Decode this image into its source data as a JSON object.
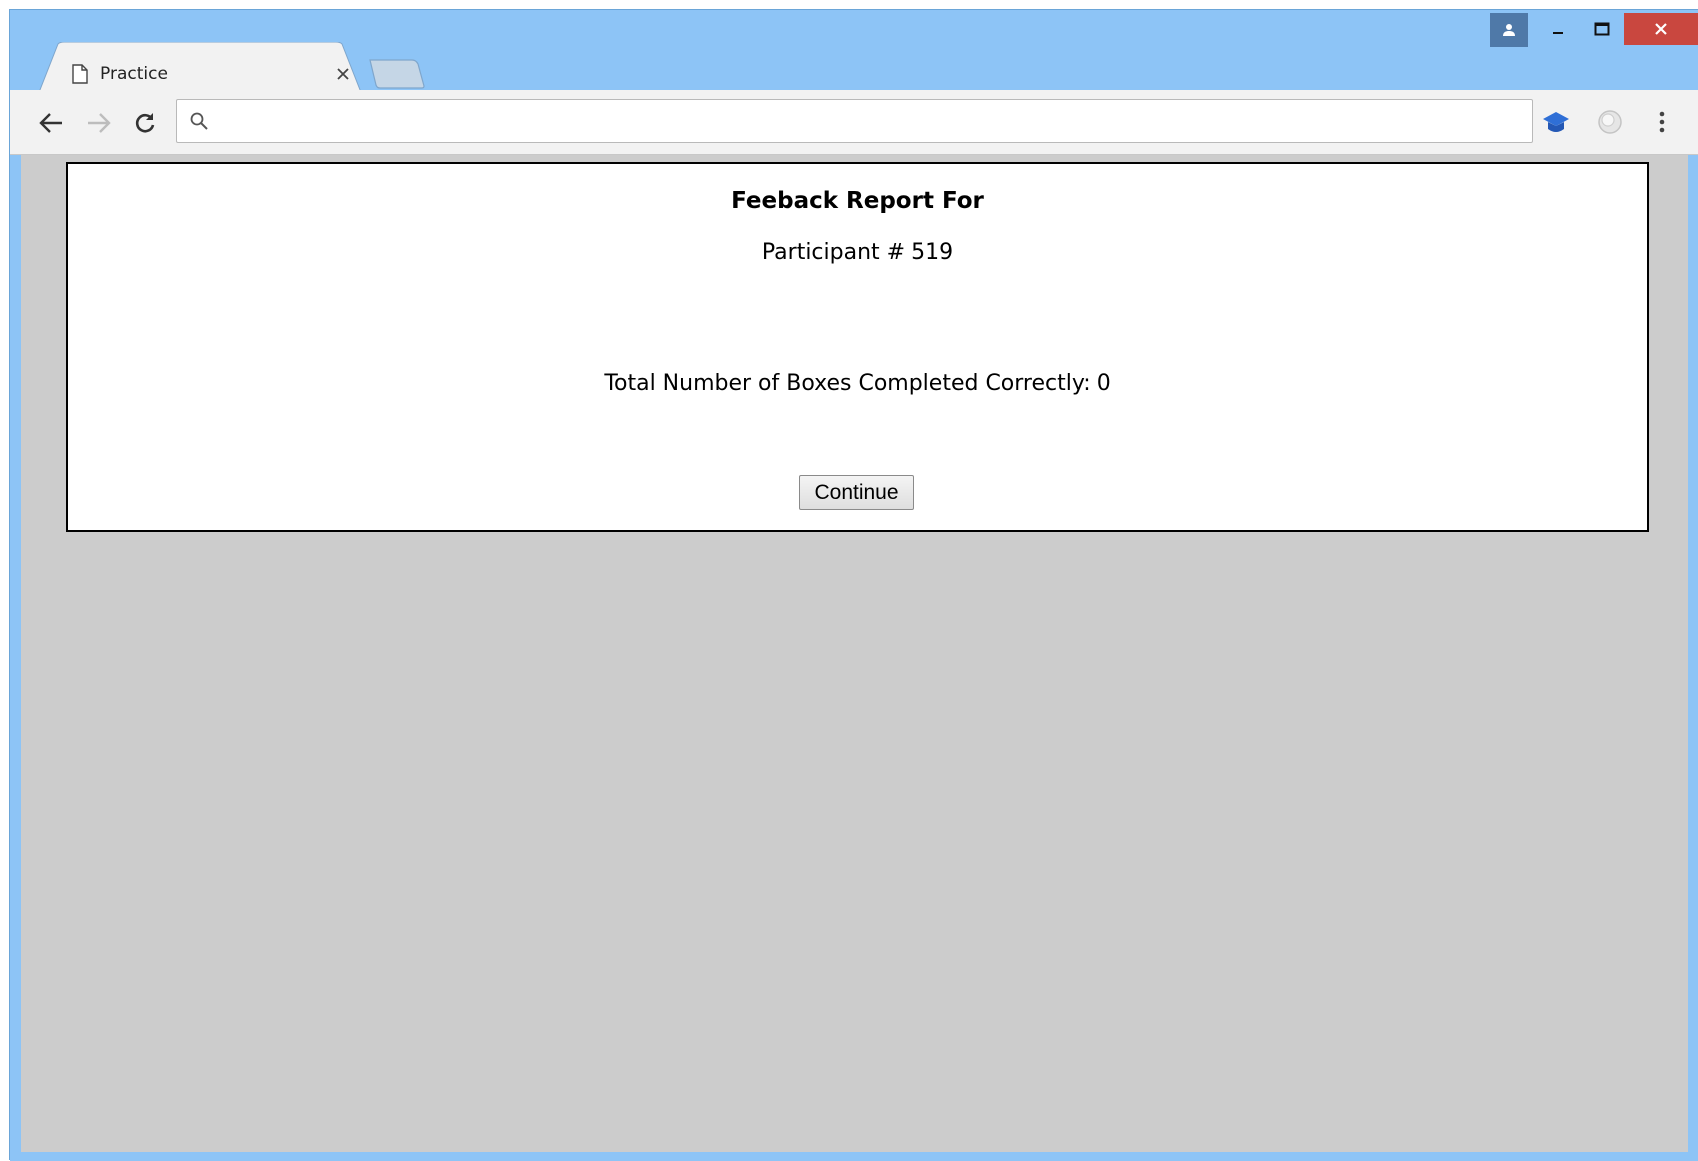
{
  "browser": {
    "tab_title": "Practice",
    "omnibox_value": "",
    "accent_color": "#8dc4f6",
    "close_color": "#c9473f"
  },
  "icons": {
    "profile": "person-icon",
    "minimize": "minimize-icon",
    "maximize": "maximize-icon",
    "close": "close-icon",
    "tab_page": "page-icon",
    "tab_close": "close-icon",
    "back": "back-arrow-icon",
    "forward": "forward-arrow-icon",
    "reload": "reload-icon",
    "search": "search-icon",
    "extension1": "graduation-cap-icon",
    "extension2": "extension-icon",
    "menu": "kebab-menu-icon"
  },
  "report": {
    "title": "Feeback Report For",
    "participant_label": "Participant #",
    "participant_id": "519",
    "total_label": "Total Number of Boxes Completed Correctly:",
    "total_value": "0",
    "continue_label": "Continue"
  }
}
